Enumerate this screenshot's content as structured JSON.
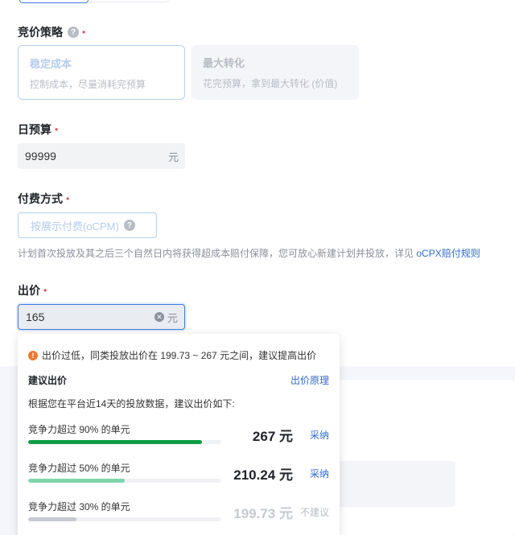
{
  "strategy": {
    "label": "竞价策略",
    "cards": [
      {
        "title": "稳定成本",
        "desc": "控制成本，尽量消耗完预算"
      },
      {
        "title": "最大转化",
        "desc": "花完预算，拿到最大转化 (价值)"
      }
    ]
  },
  "budget": {
    "label": "日预算",
    "value": "99999",
    "unit": "元"
  },
  "payment": {
    "label": "付费方式",
    "option": "按展示付费(oCPM)",
    "note": "计划首次投放及其之后三个自然日内将获得超成本赔付保障，您可放心新建计划并投放，详见",
    "note_link": "oCPX赔付规则"
  },
  "bid": {
    "label": "出价",
    "value": "165",
    "unit": "元"
  },
  "popup": {
    "warning": "出价过低，同类投放出价在 199.73 ~ 267 元之间，建议提高出价",
    "title": "建议出价",
    "link": "出价原理",
    "subtitle": "根据您在平台近14天的投放数据，建议出价如下:",
    "rows": [
      {
        "label": "竞争力超过 90% 的单元",
        "price": "267 元",
        "action": "采纳",
        "level": 0.9,
        "color": "#0f9d47"
      },
      {
        "label": "竞争力超过 50% 的单元",
        "price": "210.24 元",
        "action": "采纳",
        "level": 0.5,
        "color": "#7fd6ad"
      },
      {
        "label": "竞争力超过 30% 的单元",
        "price": "199.73 元",
        "action": "不建议",
        "level": 0.25,
        "color": "#c6c9cf"
      }
    ]
  },
  "colors": {
    "accent": "#3b7ddd",
    "link": "#2f6bd0",
    "required": "#e34d59",
    "warning": "#ed7b2f"
  },
  "icons": {
    "help": "question-circle-icon",
    "clear": "close-circle-icon",
    "warning": "exclamation-circle-icon"
  }
}
